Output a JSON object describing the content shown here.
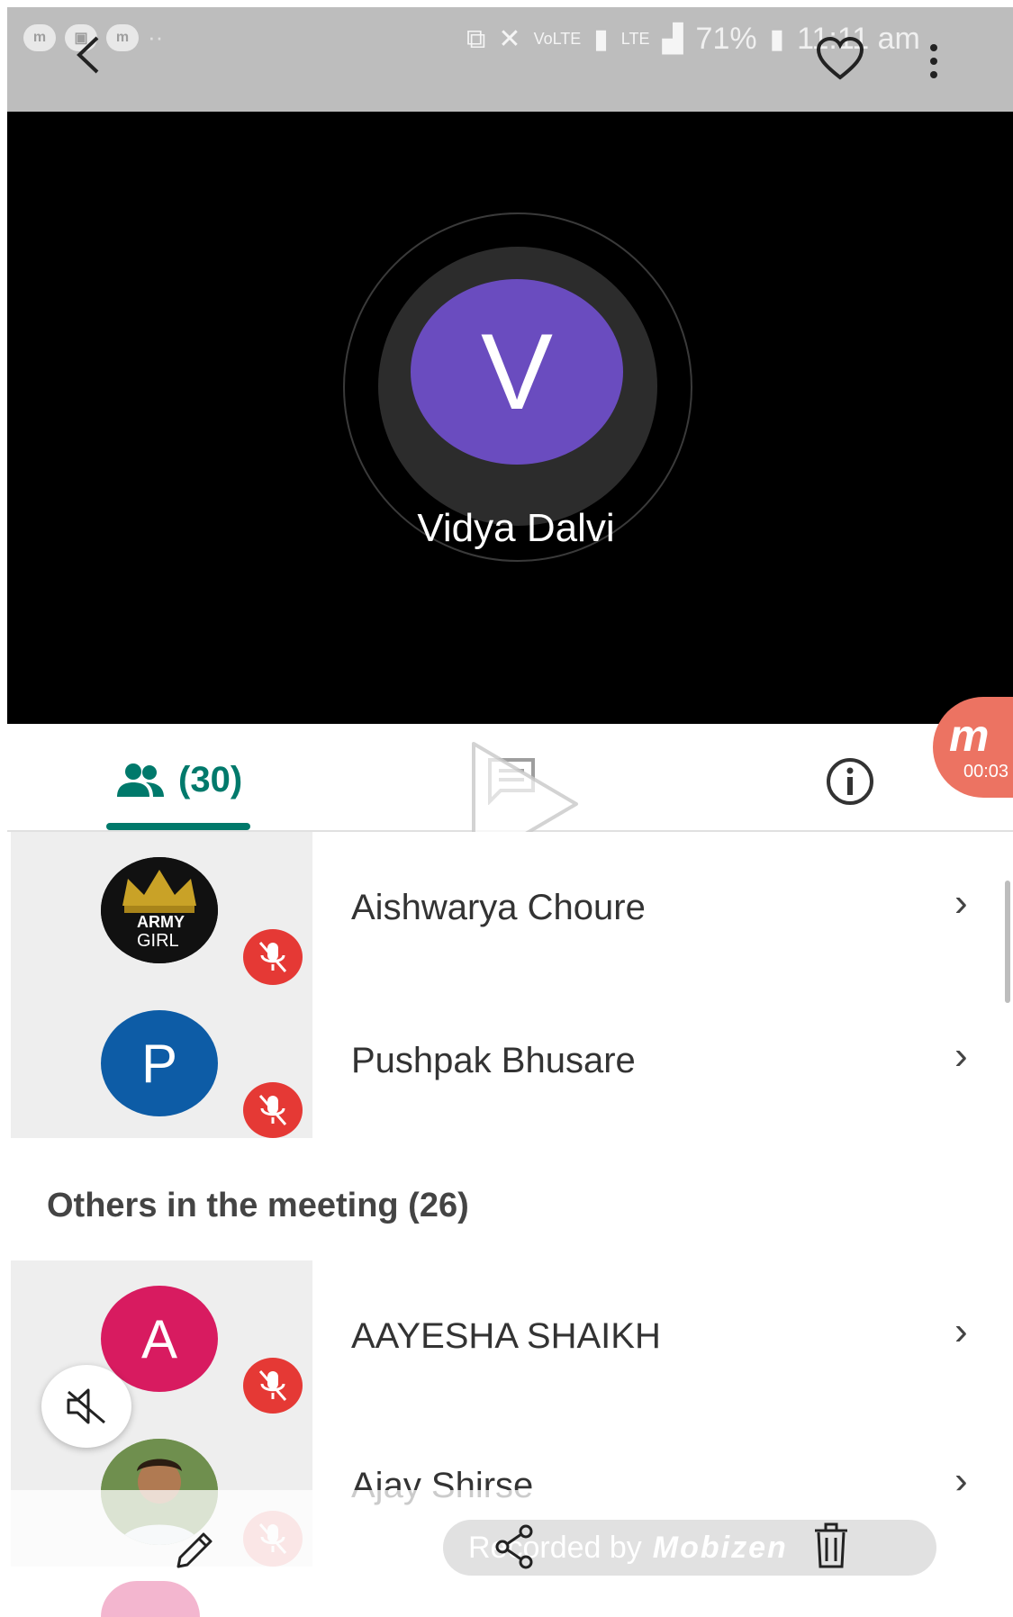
{
  "status_bar": {
    "battery": "71%",
    "time": "11:11 am",
    "icons": [
      "messenger-icon",
      "image-icon",
      "messenger-icon",
      "cast-icon",
      "mute-icon",
      "volte-icon",
      "sim-icon",
      "lte-icon",
      "signal-icon"
    ]
  },
  "toolbar": {
    "back_icon": "back-arrow-icon",
    "favorite_icon": "heart-icon",
    "more_icon": "more-vertical-icon"
  },
  "speaker": {
    "initial": "V",
    "name": "Vidya Dalvi",
    "avatar_color": "#6a4cbf"
  },
  "tabs": {
    "people_count": "(30)",
    "active_color": "#00796b"
  },
  "recording_badge": {
    "logo": "m",
    "time": "00:03"
  },
  "participants": [
    {
      "name": "Aishwarya Choure",
      "avatar_text_top": "ARMY",
      "avatar_text_bottom": "GIRL",
      "muted": true
    },
    {
      "name": "Pushpak Bhusare",
      "initial": "P",
      "avatar_color": "#0d5ca6",
      "muted": true
    }
  ],
  "others_section": {
    "title": "Others in the meeting (26)"
  },
  "others": [
    {
      "name": "AAYESHA SHAIKH",
      "initial": "A",
      "avatar_color": "#d81b60",
      "muted": true
    },
    {
      "name": "Ajay Shirse",
      "muted": true
    }
  ],
  "watermark": {
    "prefix": "Recorded by",
    "brand": "Mobizen"
  },
  "colors": {
    "mute_red": "#e53935",
    "status_bar": "#bdbdbd"
  }
}
